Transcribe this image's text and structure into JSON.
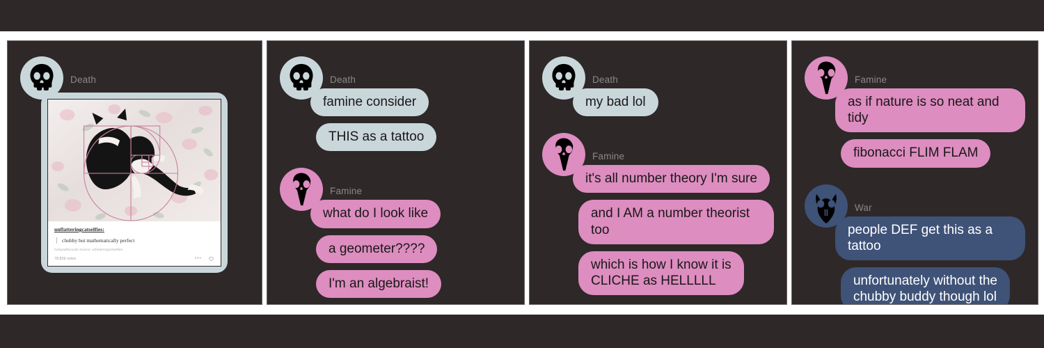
{
  "theme": {
    "page_bg": "#ffffff",
    "bar_bg": "#2e2829",
    "panel_bg": "#2e2829",
    "panel_border": "#6b6566",
    "name_label_color": "#8d8789",
    "death_color": "#c9d7da",
    "famine_color": "#dd8dc0",
    "war_color": "#3f5277",
    "spiral_color": "#c87f9e"
  },
  "speakers": {
    "death": {
      "name": "Death",
      "avatar_icon": "human-skull-icon"
    },
    "famine": {
      "name": "Famine",
      "avatar_icon": "bird-skull-icon"
    },
    "war": {
      "name": "War",
      "avatar_icon": "horned-skull-icon"
    }
  },
  "panels": [
    {
      "id": "panel-1",
      "groups": [
        {
          "speaker": "Death",
          "speaker_key": "death",
          "messages": []
        }
      ],
      "post": {
        "username": "unflatteringcatselfies:",
        "quote": "chubby but mathematically perfect",
        "source_line": "fuckyeahfuncats   Source: unflatteringcatselfies",
        "notes": "78,839 notes",
        "more_icon": "more-dots-icon",
        "like_icon": "heart-icon",
        "image_alt": "tuxedo cat curled on floral bedding with fibonacci golden spiral overlay"
      }
    },
    {
      "id": "panel-2",
      "groups": [
        {
          "speaker": "Death",
          "speaker_key": "death",
          "messages": [
            "famine consider",
            "THIS as a tattoo"
          ]
        },
        {
          "speaker": "Famine",
          "speaker_key": "famine",
          "messages": [
            "what do I look like",
            "a geometer????",
            "I'm an algebraist!"
          ]
        }
      ]
    },
    {
      "id": "panel-3",
      "groups": [
        {
          "speaker": "Death",
          "speaker_key": "death",
          "messages": [
            "my bad lol"
          ]
        },
        {
          "speaker": "Famine",
          "speaker_key": "famine",
          "messages": [
            "it's all number theory I'm sure",
            "and I AM a number theorist too",
            "which is how I know it is\nCLICHE as HELLLLL"
          ]
        }
      ]
    },
    {
      "id": "panel-4",
      "groups": [
        {
          "speaker": "Famine",
          "speaker_key": "famine",
          "messages": [
            "as if nature is so neat and tidy",
            "fibonacci FLIM FLAM"
          ]
        },
        {
          "speaker": "War",
          "speaker_key": "war",
          "messages": [
            "people DEF get this as a tattoo",
            "unfortunately without the\nchubby buddy though lol"
          ]
        }
      ]
    }
  ]
}
